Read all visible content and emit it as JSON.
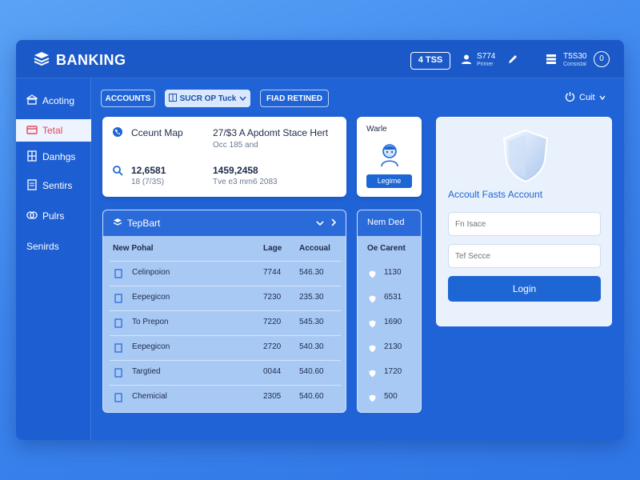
{
  "header": {
    "brand": "BANKING",
    "pill": "4 TSS",
    "user": {
      "line1": "S774",
      "line2": "Primer"
    },
    "account": {
      "line1": "T5S30",
      "line2": "Consistal"
    }
  },
  "sidebar": {
    "items": [
      {
        "label": "Acoting",
        "icon": "bank-icon"
      },
      {
        "label": "Tetal",
        "icon": "wallet-icon"
      },
      {
        "label": "Danhgs",
        "icon": "building-icon"
      },
      {
        "label": "Sentirs",
        "icon": "document-icon"
      },
      {
        "label": "Pulrs",
        "icon": "coins-icon"
      },
      {
        "label": "Senirds",
        "icon": ""
      }
    ],
    "active_index": 1
  },
  "toolbar": {
    "accounts": "ACCOUNTS",
    "mid": "SUCR OP Tuck",
    "right": "FIAD RETINED",
    "quit": "Cuit"
  },
  "summary": {
    "row1": {
      "title": "Cceunt Map",
      "value_title": "27/$3 A Apdomt Stace Hert",
      "value_sub": "Occ 185 and"
    },
    "row2": {
      "title": "12,6581",
      "sub": "18 (7/3S)",
      "value_title": "1459,2458",
      "value_sub": "Tve e3 mm6 2083"
    }
  },
  "profile": {
    "title": "Warle",
    "button": "Legime"
  },
  "table": {
    "title": "TepBart",
    "columns": [
      "New Pohal",
      "Lage",
      "Accoual"
    ],
    "rows": [
      {
        "name": "Celinpoion",
        "lage": "7744",
        "account": "546.30"
      },
      {
        "name": "Eepegicon",
        "lage": "7230",
        "account": "235.30"
      },
      {
        "name": "To Prepon",
        "lage": "7220",
        "account": "545.30"
      },
      {
        "name": "Eepegicon",
        "lage": "2720",
        "account": "540.30"
      },
      {
        "name": "Targtied",
        "lage": "0044",
        "account": "540.60"
      },
      {
        "name": "Chemicial",
        "lage": "2305",
        "account": "540.60"
      }
    ]
  },
  "side_table": {
    "title": "Nem Ded",
    "column": "Oe Carent",
    "values": [
      "1130",
      "6531",
      "1690",
      "2130",
      "1720",
      "500"
    ]
  },
  "login": {
    "title": "Accoult Fasts Account",
    "field1_placeholder": "Fn Isace",
    "field2_placeholder": "Tef Secce",
    "button": "Login"
  }
}
